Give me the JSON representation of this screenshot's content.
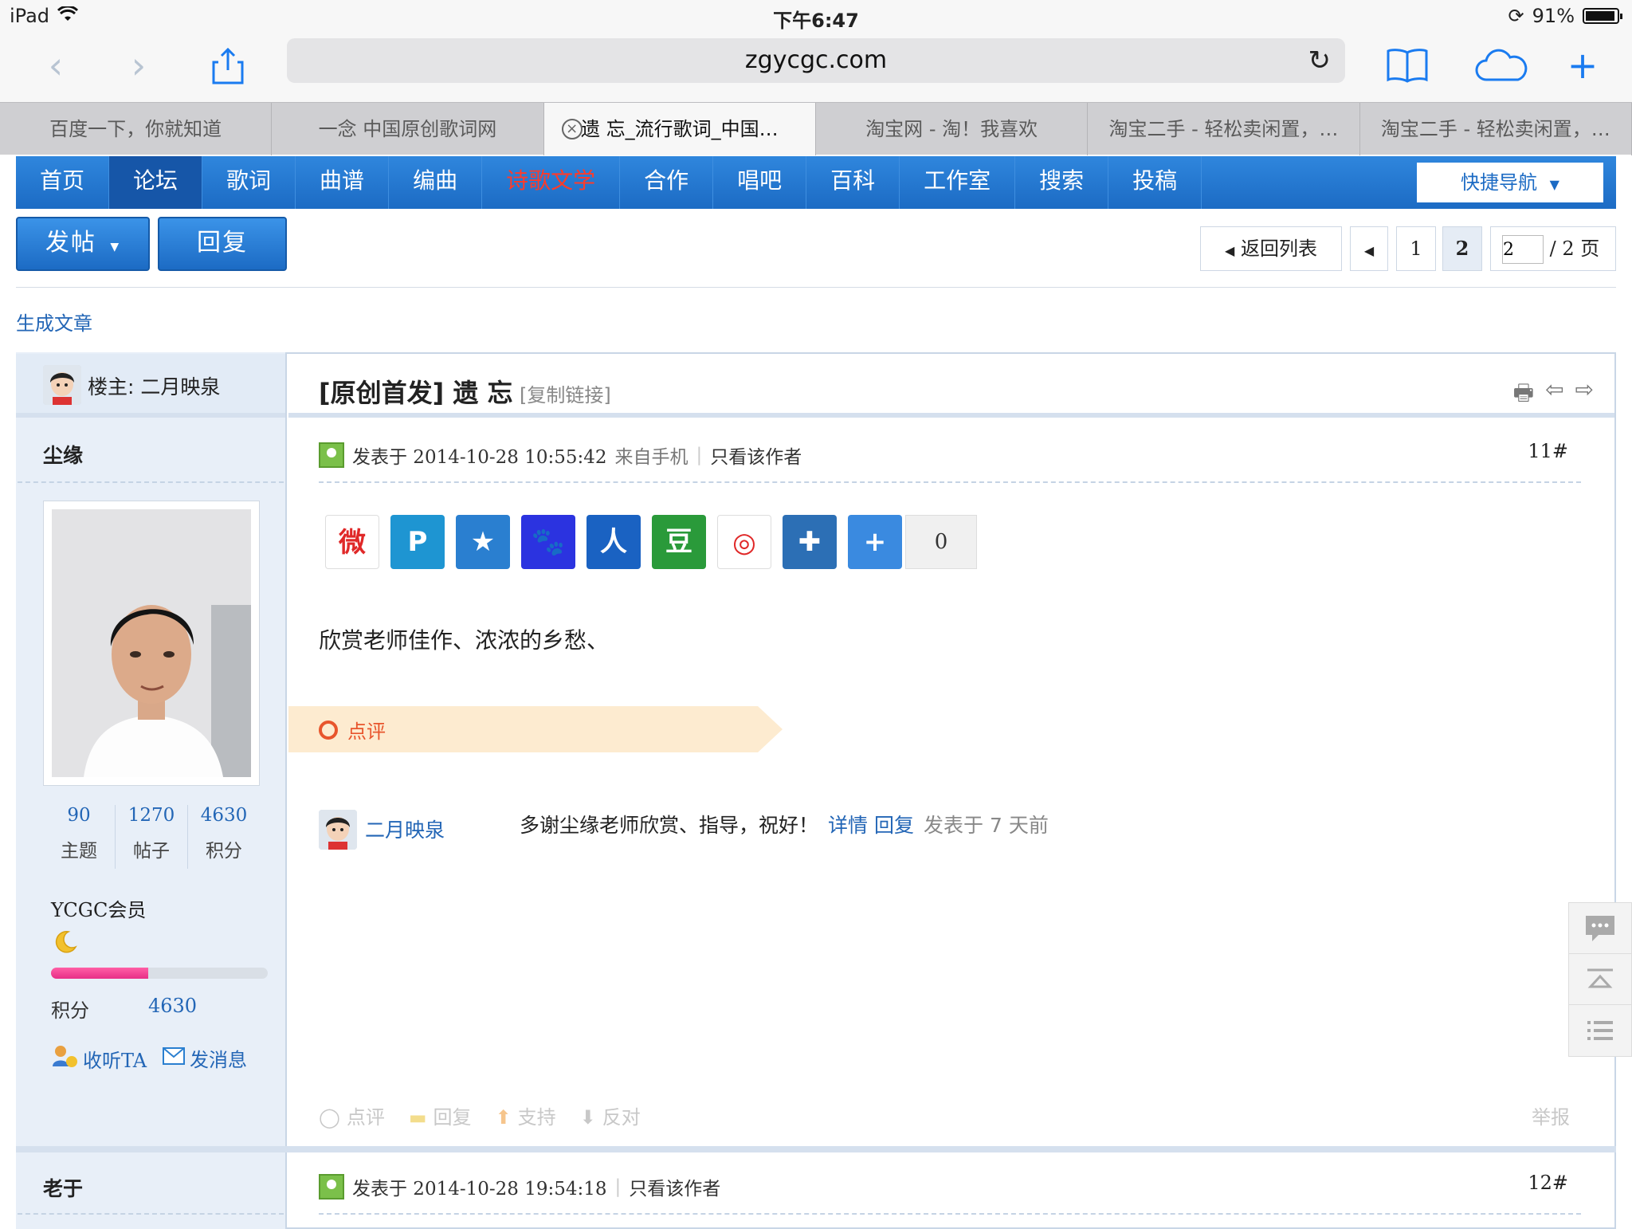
{
  "status": {
    "device": "iPad",
    "time": "下午6:47",
    "battery": "91%"
  },
  "browser": {
    "url": "zgycgc.com",
    "tabs": [
      "百度一下，你就知道",
      "一念 中国原创歌词网",
      "遗 忘_流行歌词_中国…",
      "淘宝网 - 淘！我喜欢",
      "淘宝二手 - 轻松卖闲置，…",
      "淘宝二手 - 轻松卖闲置，…"
    ],
    "active_tab": 2
  },
  "nav": {
    "items": [
      "首页",
      "论坛",
      "歌词",
      "曲谱",
      "编曲",
      "诗歌文学",
      "合作",
      "唱吧",
      "百科",
      "工作室",
      "搜索",
      "投稿"
    ],
    "quick_nav": "快捷导航"
  },
  "actions": {
    "post": "发帖",
    "reply": "回复"
  },
  "pager": {
    "back": "返回列表",
    "page1": "1",
    "page2": "2",
    "input_value": "2",
    "total": "/ 2 页"
  },
  "gen_article": "生成文章",
  "thread": {
    "owner_label": "楼主: 二月映泉",
    "title": "[原创首发] 遗 忘",
    "copy_link": "[复制链接]"
  },
  "post1": {
    "author": "尘缘",
    "meta_posted": "发表于 2014-10-28 10:55:42",
    "meta_mobile": "来自手机",
    "meta_only": "只看该作者",
    "floor": "11#",
    "share_count": "0",
    "body": "欣赏老师佳作、浓浓的乡愁、",
    "stats": [
      {
        "n": "90",
        "l": "主题"
      },
      {
        "n": "1270",
        "l": "帖子"
      },
      {
        "n": "4630",
        "l": "积分"
      }
    ],
    "group": "YCGC会员",
    "progress": 0.45,
    "credit_label": "积分",
    "credit_value": "4630",
    "follow": "收听TA",
    "message": "发消息",
    "comment_banner": "点评",
    "comment": {
      "user": "二月映泉",
      "text": "多谢尘缘老师欣赏、指导，祝好！",
      "detail": "详情",
      "reply": "回复",
      "time": "发表于 7 天前"
    },
    "bottom_actions": [
      "点评",
      "回复",
      "支持",
      "反对"
    ],
    "report": "举报"
  },
  "post2": {
    "author": "老于",
    "meta_posted": "发表于 2014-10-28 19:54:18",
    "meta_only": "只看该作者",
    "floor": "12#"
  },
  "share_icons": [
    {
      "name": "weibo-icon",
      "color": "#ffffff",
      "glyph": "微"
    },
    {
      "name": "tencent-weibo-icon",
      "color": "#1e95d2",
      "glyph": "P"
    },
    {
      "name": "qzone-icon",
      "color": "#2a7fd0",
      "glyph": "★"
    },
    {
      "name": "baidu-icon",
      "color": "#2b33e0",
      "glyph": "🐾"
    },
    {
      "name": "renren-icon",
      "color": "#1a62c2",
      "glyph": "人"
    },
    {
      "name": "douban-icon",
      "color": "#2a9a3a",
      "glyph": "豆"
    },
    {
      "name": "tencent-news-icon",
      "color": "#ffffff",
      "glyph": "◎"
    },
    {
      "name": "msn-icon",
      "color": "#2c6fb5",
      "glyph": "✚"
    },
    {
      "name": "more-share-icon",
      "color": "#3a8ae0",
      "glyph": "+"
    }
  ]
}
